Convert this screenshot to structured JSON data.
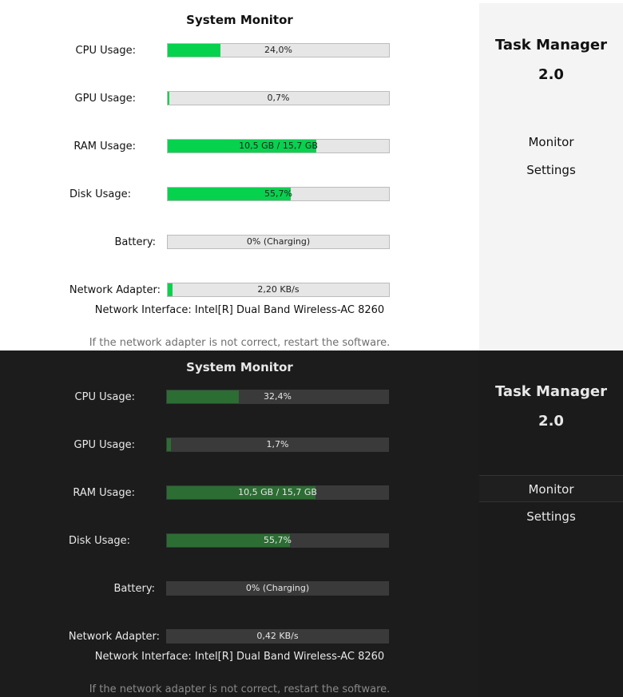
{
  "light": {
    "title": "System Monitor",
    "rows": [
      {
        "label": "CPU Usage:",
        "value": "24,0%",
        "fraction": 0.24
      },
      {
        "label": "GPU Usage:",
        "value": "0,7%",
        "fraction": 0.007
      },
      {
        "label": "RAM Usage:",
        "value": "10,5 GB / 15,7 GB",
        "fraction": 0.67
      },
      {
        "label": "Disk Usage:",
        "value": "55,7%",
        "fraction": 0.557
      },
      {
        "label": "Battery:",
        "value": "0% (Charging)",
        "fraction": 0
      },
      {
        "label": "Network Adapter:",
        "value": "2,20 KB/s",
        "fraction": 0.02
      }
    ],
    "interface": "Network Interface: Intel[R] Dual Band Wireless-AC 8260",
    "hint": "If the network adapter is not correct, restart the software.",
    "app_title_line1": "Task Manager",
    "app_title_line2": "2.0",
    "nav": [
      "Monitor",
      "Settings"
    ]
  },
  "dark": {
    "title": "System Monitor",
    "rows": [
      {
        "label": "CPU Usage:",
        "value": "32,4%",
        "fraction": 0.324
      },
      {
        "label": "GPU Usage:",
        "value": "1,7%",
        "fraction": 0.017
      },
      {
        "label": "RAM Usage:",
        "value": "10,5 GB / 15,7 GB",
        "fraction": 0.67
      },
      {
        "label": "Disk Usage:",
        "value": "55,7%",
        "fraction": 0.557
      },
      {
        "label": "Battery:",
        "value": "0% (Charging)",
        "fraction": 0
      },
      {
        "label": "Network Adapter:",
        "value": "0,42 KB/s",
        "fraction": 0
      }
    ],
    "interface": "Network Interface: Intel[R] Dual Band Wireless-AC 8260",
    "hint": "If the network adapter is not correct, restart the software.",
    "app_title_line1": "Task Manager",
    "app_title_line2": "2.0",
    "nav": [
      "Monitor",
      "Settings"
    ]
  },
  "colors": {
    "light_fill": "#06d24e",
    "dark_fill": "#2c6d33",
    "dark_bg": "#1c1c1c"
  }
}
